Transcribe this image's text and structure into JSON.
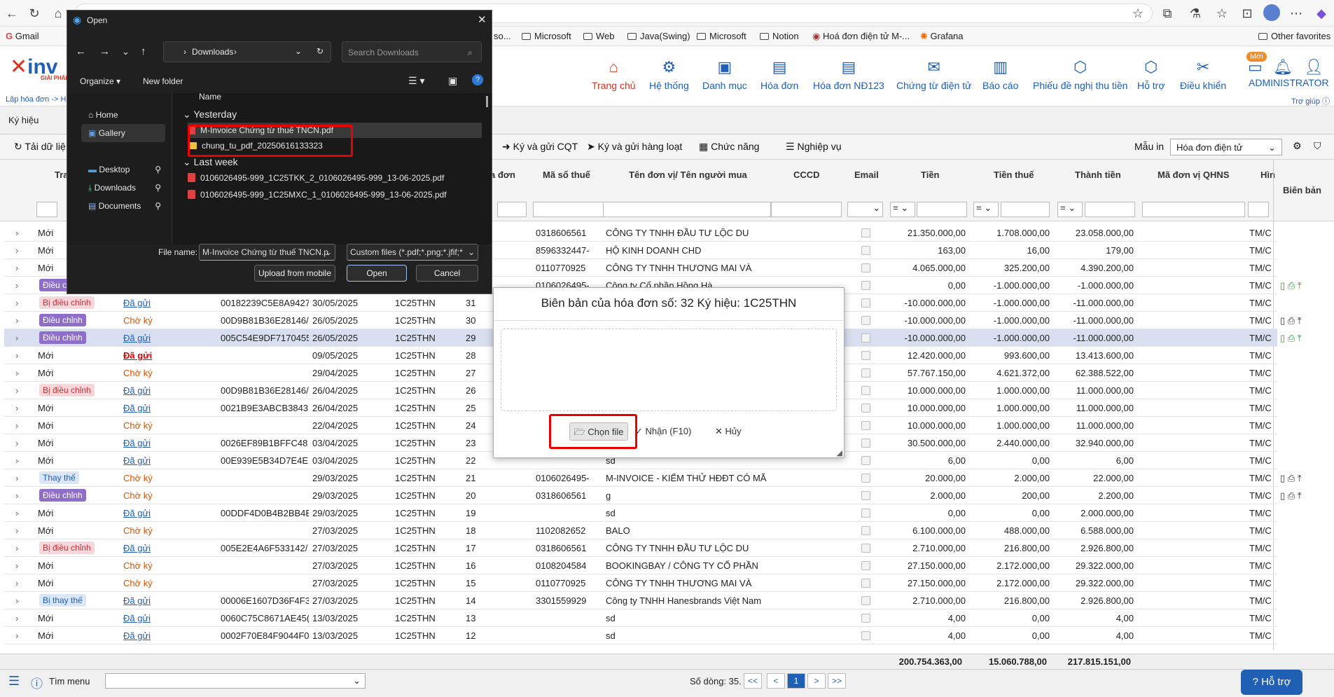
{
  "bookmarks": {
    "gmail": "Gmail",
    "so": "so...",
    "microsoft1": "Microsoft",
    "web": "Web",
    "java": "Java(Swing)",
    "microsoft2": "Microsoft",
    "notion": "Notion",
    "hoadon": "Hoá đơn điện tử M-...",
    "grafana": "Grafana",
    "other": "Other favorites"
  },
  "logo": "inv",
  "logo_sub": "GIẢI PHÁP",
  "breadcrumb": "Lập hóa đơn -> H",
  "nav": {
    "trangchu": "Trang chủ",
    "hethong": "Hệ thống",
    "danhmuc": "Danh mục",
    "hoadon": "Hóa đơn",
    "hoadon123": "Hóa đơn NĐ123",
    "chungtu": "Chứng từ điện tử",
    "baocao": "Báo cáo",
    "phieu": "Phiếu đề nghị thu tiền",
    "hotro": "Hỗ trợ",
    "dieukhien": "Điều khiển",
    "user": "ADMINISTRATOR",
    "moi": "Mới",
    "trogiup": "Trợ giúp"
  },
  "tab": {
    "kyhieu": "Ký hiệu"
  },
  "toolbar": {
    "tai": "Tải dữ liệ",
    "kygui": "Ký và gửi CQT",
    "kyhangloat": "Ký và gửi hàng loạt",
    "chucnang": "Chức năng",
    "nghiepvu": "Nghiệp vụ",
    "mauin": "Mẫu in",
    "mauin_value": "Hóa đơn điện tử"
  },
  "columns": {
    "tra": "Tra",
    "mst": "Mã số thuế",
    "donvi": "Tên đơn vị/ Tên người mua",
    "cccd": "CCCD",
    "email": "Email",
    "tien": "Tiền",
    "tienthue": "Tiền thuế",
    "thanhtien": "Thành tiền",
    "qhns": "Mã đơn vị QHNS",
    "hin": "Hìn",
    "bienban": "Biên bản",
    "hoadon": "a đơn"
  },
  "filters": {
    "eq": "="
  },
  "rows": [
    {
      "type": "Mới",
      "status": "",
      "code": "",
      "date": "",
      "kh": "",
      "so": "",
      "mst": "0318606561",
      "ten": "CÔNG TY TNHH ĐẦU TƯ LỘC DU",
      "tien": "21.350.000,00",
      "thue": "1.708.000,00",
      "tt": "23.058.000,00",
      "hin": "TM/C"
    },
    {
      "type": "Mới",
      "status": "",
      "code": "",
      "date": "",
      "kh": "",
      "so": "",
      "mst": "8596332447-",
      "ten": "HỘ KINH DOANH CHD",
      "tien": "163,00",
      "thue": "16,00",
      "tt": "179,00",
      "hin": "TM/C"
    },
    {
      "type": "Mới",
      "status": "",
      "code": "",
      "date": "",
      "kh": "",
      "so": "",
      "mst": "0110770925",
      "ten": "CÔNG TY TNHH THƯƠNG MAI VÀ",
      "tien": "4.065.000,00",
      "thue": "325.200,00",
      "tt": "4.390.200,00",
      "hin": "TM/C"
    },
    {
      "type": "Điều c",
      "status": "",
      "code": "",
      "date": "",
      "kh": "",
      "so": "",
      "mst": "0106026495-",
      "ten": "Công ty Cổ phần Hồng Hà",
      "tien": "0,00",
      "thue": "-1.000.000,00",
      "tt": "-1.000.000,00",
      "hin": "TM/C"
    },
    {
      "type": "Bị điều chỉnh",
      "status": "Đã gửi",
      "code": "00182239C5E8A9427",
      "date": "30/05/2025",
      "kh": "1C25THN",
      "so": "31",
      "mst": "",
      "ten": "",
      "tien": "-10.000.000,00",
      "thue": "-1.000.000,00",
      "tt": "-11.000.000,00",
      "hin": "TM/C"
    },
    {
      "type": "Điều chỉnh",
      "status": "Chờ ký",
      "code": "00D9B81B36E28146/",
      "date": "26/05/2025",
      "kh": "1C25THN",
      "so": "30",
      "mst": "",
      "ten": "",
      "tien": "-10.000.000,00",
      "thue": "-1.000.000,00",
      "tt": "-11.000.000,00",
      "hin": "TM/C"
    },
    {
      "type": "Điều chỉnh",
      "status": "Đã gửi",
      "code": "005C54E9DF7170455",
      "date": "26/05/2025",
      "kh": "1C25THN",
      "so": "29",
      "mst": "",
      "ten": "",
      "tien": "-10.000.000,00",
      "thue": "-1.000.000,00",
      "tt": "-11.000.000,00",
      "hin": "TM/C"
    },
    {
      "type": "Mới",
      "status": "Đã gửi",
      "code": "",
      "date": "09/05/2025",
      "kh": "1C25THN",
      "so": "28",
      "mst": "",
      "ten": "",
      "tien": "12.420.000,00",
      "thue": "993.600,00",
      "tt": "13.413.600,00",
      "hin": "TM/C"
    },
    {
      "type": "Mới",
      "status": "Chờ ký",
      "code": "",
      "date": "29/04/2025",
      "kh": "1C25THN",
      "so": "27",
      "mst": "",
      "ten": "",
      "tien": "57.767.150,00",
      "thue": "4.621.372,00",
      "tt": "62.388.522,00",
      "hin": "TM/C"
    },
    {
      "type": "Bị điều chỉnh",
      "status": "Đã gửi",
      "code": "00D9B81B36E28146/",
      "date": "26/04/2025",
      "kh": "1C25THN",
      "so": "26",
      "mst": "",
      "ten": "",
      "tien": "10.000.000,00",
      "thue": "1.000.000,00",
      "tt": "11.000.000,00",
      "hin": "TM/C"
    },
    {
      "type": "Mới",
      "status": "Đã gửi",
      "code": "0021B9E3ABCB3843",
      "date": "26/04/2025",
      "kh": "1C25THN",
      "so": "25",
      "mst": "",
      "ten": "",
      "tien": "10.000.000,00",
      "thue": "1.000.000,00",
      "tt": "11.000.000,00",
      "hin": "TM/C"
    },
    {
      "type": "Mới",
      "status": "Chờ ký",
      "code": "",
      "date": "22/04/2025",
      "kh": "1C25THN",
      "so": "24",
      "mst": "",
      "ten": "",
      "tien": "10.000.000,00",
      "thue": "1.000.000,00",
      "tt": "11.000.000,00",
      "hin": "TM/C"
    },
    {
      "type": "Mới",
      "status": "Đã gửi",
      "code": "0026EF89B1BFFC48",
      "date": "03/04/2025",
      "kh": "1C25THN",
      "so": "23",
      "mst": "",
      "ten": "",
      "tien": "30.500.000,00",
      "thue": "2.440.000,00",
      "tt": "32.940.000,00",
      "hin": "TM/C"
    },
    {
      "type": "Mới",
      "status": "Đã gửi",
      "code": "00E939E5B34D7E4E",
      "date": "03/04/2025",
      "kh": "1C25THN",
      "so": "22",
      "mst": "",
      "ten": "sd",
      "tien": "6,00",
      "thue": "0,00",
      "tt": "6,00",
      "hin": "TM/C"
    },
    {
      "type": "Thay thế",
      "status": "Chờ ký",
      "code": "",
      "date": "29/03/2025",
      "kh": "1C25THN",
      "so": "21",
      "mst": "0106026495-",
      "ten": "M-INVOICE - KIỂM THỬ HĐĐT CÓ MÃ",
      "tien": "20.000,00",
      "thue": "2.000,00",
      "tt": "22.000,00",
      "hin": "TM/C"
    },
    {
      "type": "Điều chỉnh",
      "status": "Chờ ký",
      "code": "",
      "date": "29/03/2025",
      "kh": "1C25THN",
      "so": "20",
      "mst": "0318606561",
      "ten": "g",
      "tien": "2.000,00",
      "thue": "200,00",
      "tt": "2.200,00",
      "hin": "TM/C"
    },
    {
      "type": "Mới",
      "status": "Đã gửi",
      "code": "00DDF4D0B4B2BB4E",
      "date": "29/03/2025",
      "kh": "1C25THN",
      "so": "19",
      "mst": "",
      "ten": "sd",
      "tien": "0,00",
      "thue": "0,00",
      "tt": "2.000.000,00",
      "hin": "TM/C"
    },
    {
      "type": "Mới",
      "status": "Chờ ký",
      "code": "",
      "date": "27/03/2025",
      "kh": "1C25THN",
      "so": "18",
      "mst": "1102082652",
      "ten": "BALO",
      "tien": "6.100.000,00",
      "thue": "488.000,00",
      "tt": "6.588.000,00",
      "hin": "TM/C"
    },
    {
      "type": "Bị điều chỉnh",
      "status": "Đã gửi",
      "code": "005E2E4A6F533142/",
      "date": "27/03/2025",
      "kh": "1C25THN",
      "so": "17",
      "mst": "0318606561",
      "ten": "CÔNG TY TNHH ĐẦU TƯ LỘC DU",
      "tien": "2.710.000,00",
      "thue": "216.800,00",
      "tt": "2.926.800,00",
      "hin": "TM/C"
    },
    {
      "type": "Mới",
      "status": "Chờ ký",
      "code": "",
      "date": "27/03/2025",
      "kh": "1C25THN",
      "so": "16",
      "mst": "0108204584",
      "ten": "BOOKINGBAY / CÔNG TY CỔ PHẦN",
      "tien": "27.150.000,00",
      "thue": "2.172.000,00",
      "tt": "29.322.000,00",
      "hin": "TM/C"
    },
    {
      "type": "Mới",
      "status": "Chờ ký",
      "code": "",
      "date": "27/03/2025",
      "kh": "1C25THN",
      "so": "15",
      "mst": "0110770925",
      "ten": "CÔNG TY TNHH THƯƠNG MAI VÀ",
      "tien": "27.150.000,00",
      "thue": "2.172.000,00",
      "tt": "29.322.000,00",
      "hin": "TM/C"
    },
    {
      "type": "Bị thay thế",
      "status": "Đã gửi",
      "code": "00006E1607D36F4F3",
      "date": "27/03/2025",
      "kh": "1C25THN",
      "so": "14",
      "mst": "3301559929",
      "ten": "Công ty TNHH Hanesbrands Việt Nam",
      "tien": "2.710.000,00",
      "thue": "216.800,00",
      "tt": "2.926.800,00",
      "hin": "TM/C"
    },
    {
      "type": "Mới",
      "status": "Đã gửi",
      "code": "0060C75C8671AE45(",
      "date": "13/03/2025",
      "kh": "1C25THN",
      "so": "13",
      "mst": "",
      "ten": "sd",
      "tien": "4,00",
      "thue": "0,00",
      "tt": "4,00",
      "hin": "TM/C"
    },
    {
      "type": "Mới",
      "status": "Đã gửi",
      "code": "0002F70E84F9044F0",
      "date": "13/03/2025",
      "kh": "1C25THN",
      "so": "12",
      "mst": "",
      "ten": "sd",
      "tien": "4,00",
      "thue": "0,00",
      "tt": "4,00",
      "hin": "TM/C"
    }
  ],
  "totals": {
    "tien": "200.754.363,00",
    "thue": "15.060.788,00",
    "tt": "217.815.151,00"
  },
  "bottom": {
    "timmenu": "Tìm menu",
    "sodong": "Số dòng: 35.",
    "first": "<<",
    "prev": "<",
    "page": "1",
    "next": ">",
    "last": ">>",
    "hotro": "Hỗ trợ"
  },
  "modal": {
    "title": "Biên bản của hóa đơn số: 32 Ký hiệu: 1C25THN",
    "chonfile": "Chọn file",
    "nhan": "Nhận (F10)",
    "huy": "Hủy"
  },
  "dialog": {
    "title": "Open",
    "path": "Downloads",
    "search_placeholder": "Search Downloads",
    "organize": "Organize",
    "newfolder": "New folder",
    "home": "Home",
    "gallery": "Gallery",
    "desktop": "Desktop",
    "downloads": "Downloads",
    "documents": "Documents",
    "col_name": "Name",
    "group_yesterday": "Yesterday",
    "group_lastweek": "Last week",
    "files": [
      {
        "name": "M-Invoice Chứng từ thuế TNCN.pdf",
        "kind": "pdf"
      },
      {
        "name": "chung_tu_pdf_20250616133323",
        "kind": "folder"
      },
      {
        "name": "0106026495-999_1C25TKK_2_0106026495-999_13-06-2025.pdf",
        "kind": "pdf"
      },
      {
        "name": "0106026495-999_1C25MXC_1_0106026495-999_13-06-2025.pdf",
        "kind": "pdf"
      }
    ],
    "filename_label": "File name:",
    "filename_value": "M-Invoice Chứng từ thuế TNCN.p",
    "filetype": "Custom files (*.pdf;*.png;*.jfif;*",
    "upload_mobile": "Upload from mobile",
    "open": "Open",
    "cancel": "Cancel"
  }
}
